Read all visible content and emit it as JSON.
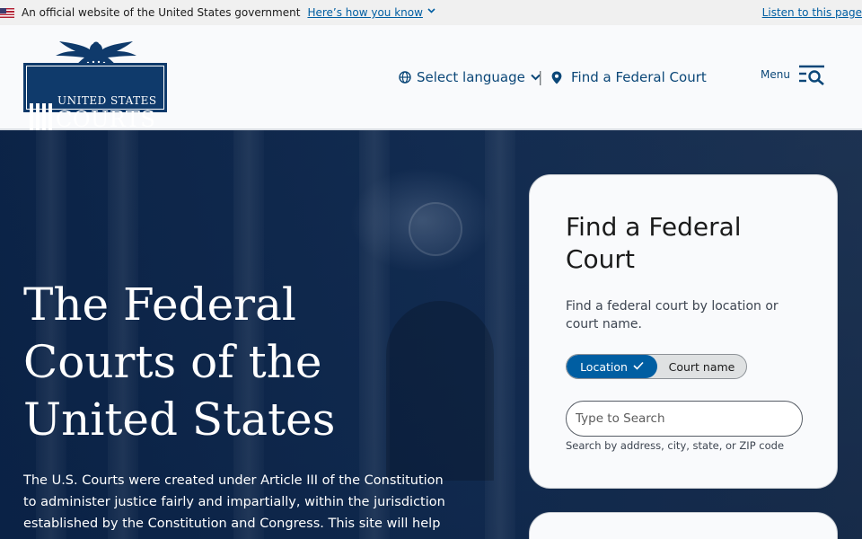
{
  "gov_banner": {
    "official_text": "An official website of the United States government",
    "how_link": "Here’s how you know",
    "listen_link": "Listen to this page"
  },
  "header": {
    "logo": {
      "line1": "UNITED STATES",
      "line2": "COURTS"
    },
    "select_language": "Select language",
    "separator": "|",
    "find_court": "Find a Federal Court",
    "menu": "Menu"
  },
  "hero": {
    "title": "The Federal Courts of the United States",
    "body": "The U.S. Courts were created under Article III of the Constitution to administer justice fairly and impartially, within the jurisdiction established by the Constitution and Congress. This site will help you"
  },
  "find_card": {
    "title": "Find a Federal Court",
    "description": "Find a federal court by location or court name.",
    "toggle": {
      "active": "Location",
      "inactive": "Court name"
    },
    "search_placeholder": "Type to Search",
    "hint": "Search by address, city, state, or ZIP code"
  },
  "colors": {
    "link_blue": "#005ea2",
    "header_blue": "#0b4778",
    "logo_navy": "#0f3a6b",
    "hero_navy": "#132a4a"
  },
  "icons": {
    "flag": "us-flag-icon",
    "chevron": "chevron-down-icon",
    "globe": "globe-icon",
    "location": "map-pin-icon",
    "menu": "menu-search-icon",
    "check": "check-icon"
  }
}
